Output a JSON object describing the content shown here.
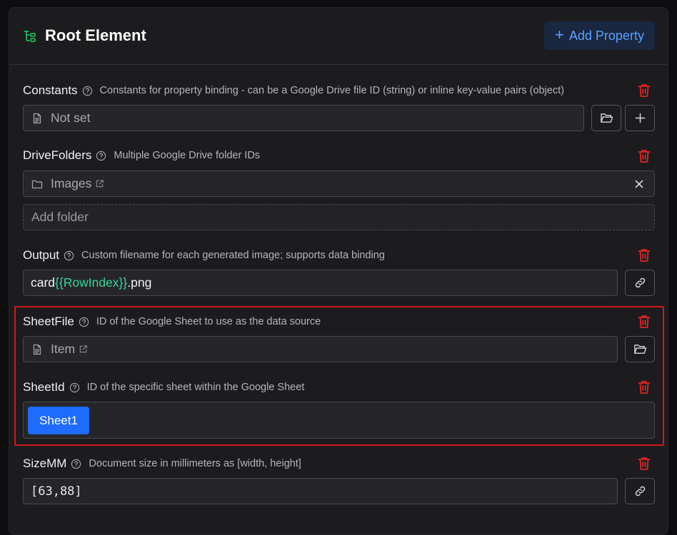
{
  "header": {
    "title": "Root Element",
    "add_property_label": "Add Property",
    "icon": "tree-structure-icon",
    "accent_color": "#5aa2ff"
  },
  "properties": {
    "constants": {
      "name": "Constants",
      "description": "Constants for property binding - can be a Google Drive file ID (string) or inline key-value pairs (object)",
      "value": "Not set"
    },
    "drive_folders": {
      "name": "DriveFolders",
      "description": "Multiple Google Drive folder IDs",
      "folders": [
        "Images"
      ],
      "add_placeholder": "Add folder"
    },
    "output": {
      "name": "Output",
      "description": "Custom filename for each generated image; supports data binding",
      "value_prefix": "card",
      "value_binding": "{{RowIndex}}",
      "value_suffix": ".png"
    },
    "sheet_file": {
      "name": "SheetFile",
      "description": "ID of the Google Sheet to use as the data source",
      "value": "Item"
    },
    "sheet_id": {
      "name": "SheetId",
      "description": "ID of the specific sheet within the Google Sheet",
      "selected": "Sheet1"
    },
    "size_mm": {
      "name": "SizeMM",
      "description": "Document size in millimeters as [width, height]",
      "value": "[63,88]"
    }
  },
  "colors": {
    "delete": "#e02424",
    "chip": "#1f6bff",
    "binding": "#34d399",
    "highlight_border": "#d11a1a"
  }
}
